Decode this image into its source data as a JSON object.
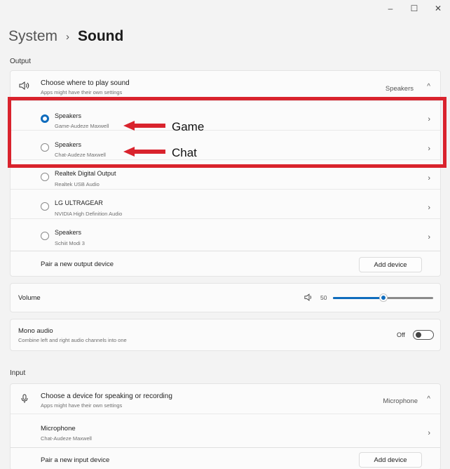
{
  "window": {
    "minimize": "–",
    "maximize": "☐",
    "close": "✕"
  },
  "breadcrumb": {
    "parent": "System",
    "separator": "›",
    "current": "Sound"
  },
  "output": {
    "section_label": "Output",
    "choose": {
      "title": "Choose where to play sound",
      "subtitle": "Apps might have their own settings",
      "selected": "Speakers",
      "expand_icon": "^"
    },
    "devices": [
      {
        "name": "Speakers",
        "detail": "Game-Audeze Maxwell",
        "selected": true
      },
      {
        "name": "Speakers",
        "detail": "Chat-Audeze Maxwell",
        "selected": false
      },
      {
        "name": "Realtek Digital Output",
        "detail": "Realtek USB Audio",
        "selected": false
      },
      {
        "name": "LG ULTRAGEAR",
        "detail": "NVIDIA High Definition Audio",
        "selected": false
      },
      {
        "name": "Speakers",
        "detail": "Schiit Modi 3",
        "selected": false
      }
    ],
    "pair_label": "Pair a new output device",
    "add_button": "Add device"
  },
  "annotations": {
    "game": "Game",
    "chat": "Chat",
    "color": "#d9232d"
  },
  "volume": {
    "label": "Volume",
    "value": "50",
    "level": 0.5
  },
  "mono": {
    "title": "Mono audio",
    "subtitle": "Combine left and right audio channels into one",
    "state": "Off"
  },
  "input": {
    "section_label": "Input",
    "choose": {
      "title": "Choose a device for speaking or recording",
      "subtitle": "Apps might have their own settings",
      "selected": "Microphone",
      "expand_icon": "^"
    },
    "devices": [
      {
        "name": "Microphone",
        "detail": "Chat-Audeze Maxwell"
      }
    ],
    "pair_label": "Pair a new input device",
    "add_button": "Add device"
  },
  "colors": {
    "accent": "#0f6cbd",
    "highlight": "#d9232d"
  }
}
